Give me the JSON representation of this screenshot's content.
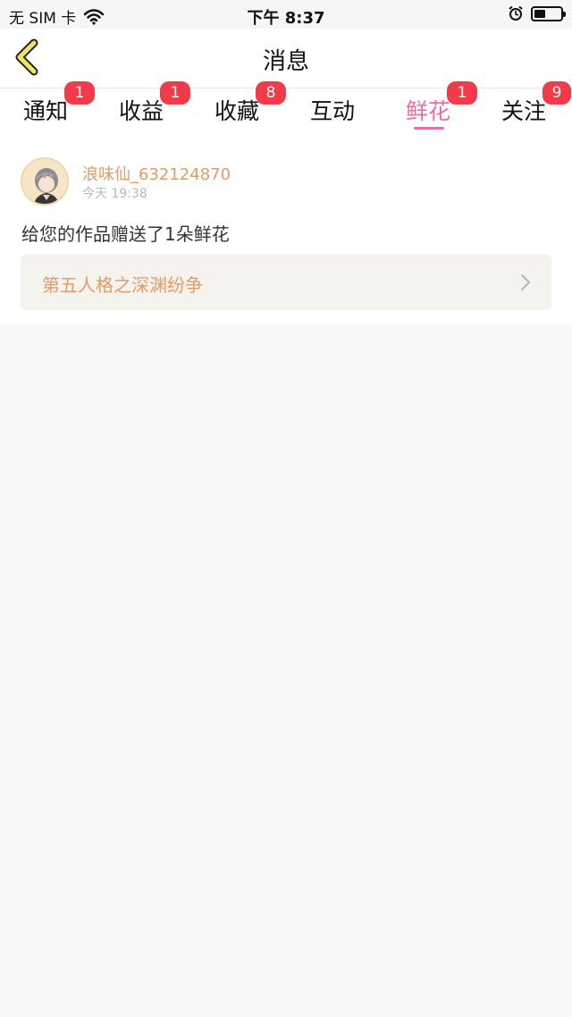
{
  "status_bar": {
    "carrier": "无 SIM 卡",
    "time": "下午 8:37"
  },
  "nav": {
    "title": "消息"
  },
  "tabs": [
    {
      "label": "通知",
      "badge": "1"
    },
    {
      "label": "收益",
      "badge": "1"
    },
    {
      "label": "收藏",
      "badge": "8"
    },
    {
      "label": "互动",
      "badge": ""
    },
    {
      "label": "鲜花",
      "badge": "1",
      "active": true
    },
    {
      "label": "关注",
      "badge": "9"
    }
  ],
  "message": {
    "username": "浪味仙_632124870",
    "time": "今天 19:38",
    "text": "给您的作品赠送了1朵鲜花",
    "work_title": "第五人格之深渊纷争"
  },
  "colors": {
    "accent": "#ef6aa7",
    "badge": "#f23b4a",
    "link_text": "#e69a66",
    "back_arrow": "#f2e45a"
  }
}
